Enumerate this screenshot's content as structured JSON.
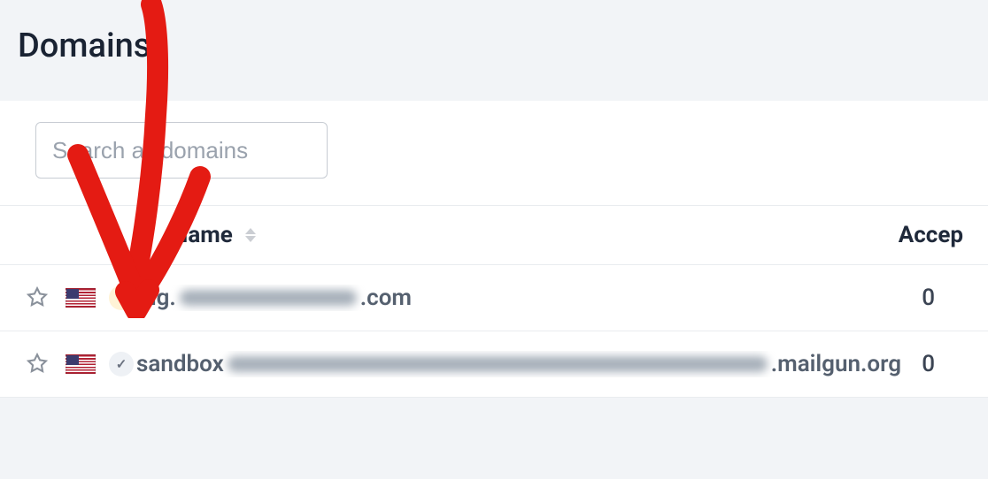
{
  "header": {
    "title": "Domains"
  },
  "search": {
    "placeholder": "Search all domains"
  },
  "columns": {
    "name": "Name",
    "accepted": "Accep"
  },
  "rows": [
    {
      "starred": false,
      "flag": "us",
      "status": "question",
      "name_prefix": "mg.",
      "name_suffix": ".com",
      "redacted_width": 200,
      "accepted": "0"
    },
    {
      "starred": false,
      "flag": "us",
      "status": "check",
      "name_prefix": "sandbox",
      "name_suffix": ".mailgun.org",
      "redacted_width": 630,
      "accepted": "0"
    }
  ]
}
